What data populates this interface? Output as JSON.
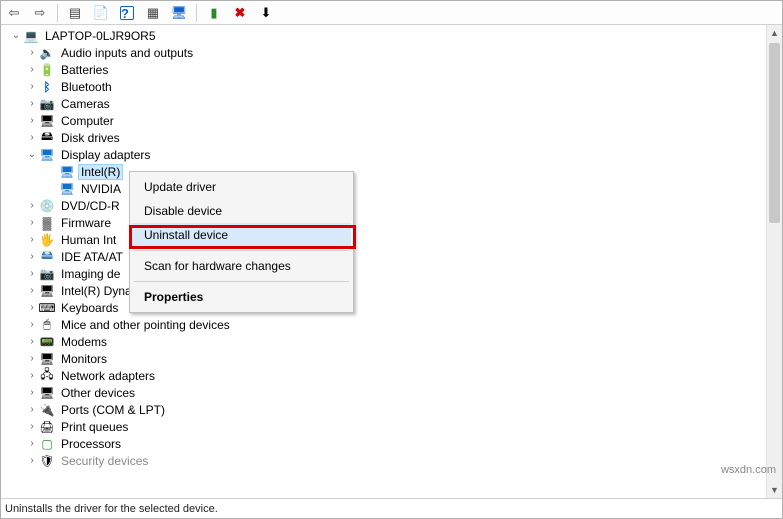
{
  "toolbar": {
    "icons": [
      {
        "name": "back-icon",
        "glyph": "⇦"
      },
      {
        "name": "forward-icon",
        "glyph": "⇨"
      },
      {
        "sep": true
      },
      {
        "name": "show-hidden-icon",
        "glyph": "▤"
      },
      {
        "name": "properties-icon",
        "glyph": "📄"
      },
      {
        "name": "help-icon",
        "glyph": "?",
        "style": "color:#1060d0;font-weight:700;border:1px solid #1060d0;width:14px;height:14px;border-radius:2px;"
      },
      {
        "name": "refresh-icon",
        "glyph": "▦"
      },
      {
        "name": "scan-icon",
        "glyph": "🖥",
        "style": "color:#1060d0;"
      },
      {
        "sep": true
      },
      {
        "name": "enable-icon",
        "glyph": "▮",
        "style": "color:#2a8a2a;"
      },
      {
        "name": "disable-icon",
        "glyph": "✖",
        "style": "color:#d40000;font-weight:700;"
      },
      {
        "name": "update-icon",
        "glyph": "⬇",
        "style": "color:#000;"
      }
    ]
  },
  "tree": {
    "root": {
      "label": "LAPTOP-0LJR9OR5",
      "icon": "💻",
      "expanded": true
    },
    "categories": [
      {
        "label": "Audio inputs and outputs",
        "icon": "🔉",
        "expanded": false
      },
      {
        "label": "Batteries",
        "icon": "🔋",
        "expanded": false
      },
      {
        "label": "Bluetooth",
        "icon": "ᛒ",
        "iconStyle": "color:#1060d0;font-weight:700;",
        "expanded": false
      },
      {
        "label": "Cameras",
        "icon": "📷",
        "expanded": false
      },
      {
        "label": "Computer",
        "icon": "🖥",
        "expanded": false
      },
      {
        "label": "Disk drives",
        "icon": "🖴",
        "expanded": false
      },
      {
        "label": "Display adapters",
        "icon": "🖥",
        "iconStyle": "color:#1070d0;",
        "expanded": true,
        "children": [
          {
            "label": "Intel(R)",
            "icon": "🖥",
            "iconStyle": "color:#1070d0;",
            "selected": true
          },
          {
            "label": "NVIDIA",
            "icon": "🖥",
            "iconStyle": "color:#1070d0;"
          }
        ]
      },
      {
        "label": "DVD/CD-R",
        "icon": "💿",
        "expanded": false,
        "truncated": true
      },
      {
        "label": "Firmware",
        "icon": "▓",
        "iconStyle": "color:#666;",
        "expanded": false
      },
      {
        "label": "Human Int",
        "icon": "🖐",
        "iconStyle": "color:#c08030;",
        "expanded": false,
        "truncated": true
      },
      {
        "label": "IDE ATA/AT",
        "icon": "🖴",
        "iconStyle": "color:#3a7ab0;",
        "expanded": false,
        "truncated": true
      },
      {
        "label": "Imaging de",
        "icon": "📷",
        "iconStyle": "color:#3a7ab0;",
        "expanded": false,
        "truncated": true
      },
      {
        "label": "Intel(R) Dynamic Platform and Thermal Framework",
        "icon": "🖥",
        "expanded": false
      },
      {
        "label": "Keyboards",
        "icon": "⌨",
        "expanded": false
      },
      {
        "label": "Mice and other pointing devices",
        "icon": "🖱",
        "expanded": false
      },
      {
        "label": "Modems",
        "icon": "📟",
        "expanded": false
      },
      {
        "label": "Monitors",
        "icon": "🖥",
        "expanded": false
      },
      {
        "label": "Network adapters",
        "icon": "🖧",
        "expanded": false
      },
      {
        "label": "Other devices",
        "icon": "🖥",
        "expanded": false
      },
      {
        "label": "Ports (COM & LPT)",
        "icon": "🔌",
        "expanded": false
      },
      {
        "label": "Print queues",
        "icon": "🖨",
        "expanded": false
      },
      {
        "label": "Processors",
        "icon": "▢",
        "iconStyle": "color:#2a8a2a;",
        "expanded": false
      },
      {
        "label": "Security devices",
        "icon": "🛡",
        "expanded": false,
        "dim": true
      }
    ]
  },
  "context_menu": {
    "items": [
      {
        "label": "Update driver"
      },
      {
        "label": "Disable device"
      },
      {
        "label": "Uninstall device",
        "highlighted": true,
        "hover": true
      },
      {
        "sep": true
      },
      {
        "label": "Scan for hardware changes"
      },
      {
        "sep": true
      },
      {
        "label": "Properties",
        "bold": true
      }
    ]
  },
  "status_bar": {
    "text": "Uninstalls the driver for the selected device."
  },
  "watermark": "wsxdn.com"
}
